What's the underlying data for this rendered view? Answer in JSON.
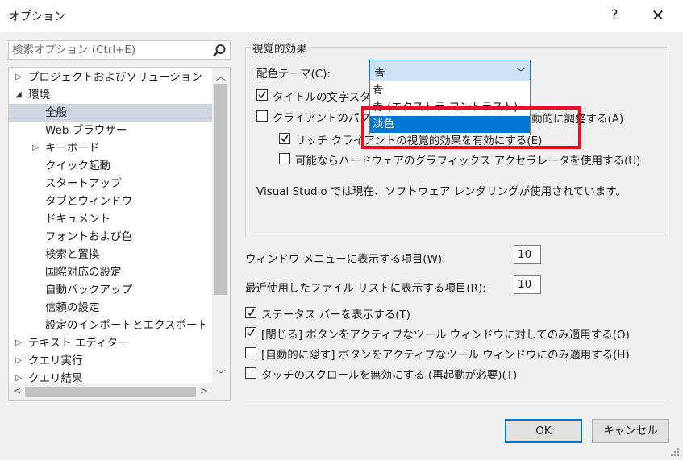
{
  "window": {
    "title": "オプション",
    "help": "?",
    "close": "✕"
  },
  "search": {
    "placeholder": "検索オプション (Ctrl+E)"
  },
  "tree": {
    "items": [
      {
        "label": "プロジェクトおよびソリューション",
        "twisty": "▷"
      },
      {
        "label": "環境",
        "twisty": "◢"
      },
      {
        "label": "全般",
        "twisty": ""
      },
      {
        "label": "Web ブラウザー",
        "twisty": ""
      },
      {
        "label": "キーボード",
        "twisty": "▷"
      },
      {
        "label": "クイック起動",
        "twisty": ""
      },
      {
        "label": "スタートアップ",
        "twisty": ""
      },
      {
        "label": "タブとウィンドウ",
        "twisty": ""
      },
      {
        "label": "ドキュメント",
        "twisty": ""
      },
      {
        "label": "フォントおよび色",
        "twisty": ""
      },
      {
        "label": "検索と置換",
        "twisty": ""
      },
      {
        "label": "国際対応の設定",
        "twisty": ""
      },
      {
        "label": "自動バックアップ",
        "twisty": ""
      },
      {
        "label": "信頼の設定",
        "twisty": ""
      },
      {
        "label": "設定のインポートとエクスポート",
        "twisty": ""
      },
      {
        "label": "テキスト エディター",
        "twisty": "▷"
      },
      {
        "label": "クエリ実行",
        "twisty": "▷"
      },
      {
        "label": "クエリ結果",
        "twisty": "▷"
      }
    ],
    "selected": "全般"
  },
  "visual": {
    "group_title": "視覚的効果",
    "theme_label": "配色テーマ(C):",
    "theme_value": "青",
    "theme_options": [
      "青",
      "青 (エクストラ コントラスト)",
      "淡色"
    ],
    "highlighted_option": "淡色",
    "title_case_label": "タイトルの文字スタイ",
    "client_perf_label": "クライアントのパフォ",
    "client_perf_tail": "動的に調整する(A)",
    "rich_visual_label": "リッチ クライアントの視覚的効果を有効にする(E)",
    "hw_accel_label": "可能ならハードウェアのグラフィックス アクセラレータを使用する(U)",
    "status_text": "Visual Studio では現在、ソフトウェア レンダリングが使用されています。"
  },
  "window_menu": {
    "label": "ウィンドウ メニューに表示する項目(W):",
    "value": "10"
  },
  "recent_files": {
    "label": "最近使用したファイル リストに表示する項目(R):",
    "value": "10"
  },
  "options": {
    "status_bar": "ステータス バーを表示する(T)",
    "close_active": "[閉じる] ボタンをアクティブなツール ウィンドウに対してのみ適用する(O)",
    "autohide_active": "[自動的に隠す] ボタンをアクティブなツール ウィンドウにのみ適用する(H)",
    "touch_scroll": "タッチのスクロールを無効にする (再起動が必要)(T)"
  },
  "buttons": {
    "ok": "OK",
    "cancel": "キャンセル"
  },
  "colors": {
    "accent": "#0078d7",
    "selection": "#cfd6e2",
    "highlight_box": "#e8101e"
  }
}
